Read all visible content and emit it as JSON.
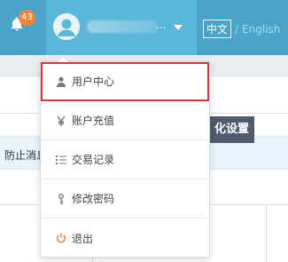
{
  "header": {
    "notification_count": "43",
    "username_suffix": "...",
    "lang_zh": "中文",
    "lang_sep": "/",
    "lang_en": "English"
  },
  "page": {
    "notice_text": "防止消息",
    "personal_button": "化设置"
  },
  "dropdown": {
    "items": [
      {
        "label": "用户中心",
        "icon": "user-icon"
      },
      {
        "label": "账户充值",
        "icon": "yen-icon"
      },
      {
        "label": "交易记录",
        "icon": "list-icon"
      },
      {
        "label": "修改密码",
        "icon": "key-icon"
      },
      {
        "label": "退出",
        "icon": "power-icon"
      }
    ]
  },
  "colors": {
    "header_bg": "#4aa3c9",
    "user_area_bg": "#5bb7d9",
    "badge": "#f0853b",
    "highlight_border": "#e0303a",
    "button_bg": "#4f5b6e"
  }
}
